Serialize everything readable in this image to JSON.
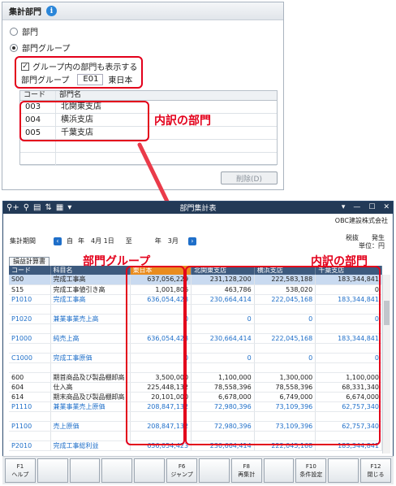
{
  "panel": {
    "title": "集計部門",
    "radio_dept": "部門",
    "radio_group": "部門グループ",
    "checkbox_label": "グループ内の部門も表示する",
    "group_label": "部門グループ",
    "group_code": "E01",
    "group_name": "東日本",
    "grid_headers": [
      "コード",
      "部門名"
    ],
    "grid_rows": [
      {
        "code": "003",
        "name": "北関東支店"
      },
      {
        "code": "004",
        "name": "横浜支店"
      },
      {
        "code": "005",
        "name": "千葉支店"
      }
    ],
    "delete_button": "削除(D)"
  },
  "callouts": {
    "detail_dept": "内訳の部門",
    "dept_group": "部門グループ"
  },
  "window": {
    "title": "部門集計表",
    "company": "OBC建設株式会社",
    "period_label": "集計期間",
    "period_from_prefix": "自",
    "period_from": "年　4月 1日",
    "period_to_prefix": "至",
    "period_to": "年　3月",
    "tax_label": "税抜　　発生",
    "unit_label": "単位：円",
    "tab_label": "損益計算書",
    "columns": [
      "コード",
      "科目名",
      "東日本",
      "北関東支店",
      "横浜支店",
      "千葉支店"
    ],
    "rows": [
      {
        "code": "S00",
        "name": "完成工事高",
        "v1": "637,056,229",
        "v2": "231,128,200",
        "v3": "222,583,188",
        "v4": "183,344,841",
        "style": "sel"
      },
      {
        "code": "S15",
        "name": "完成工事値引き高",
        "v1": "1,001,806",
        "v2": "463,786",
        "v3": "538,020",
        "v4": "0",
        "style": ""
      },
      {
        "code": "P1010",
        "name": "完成工事高",
        "v1": "636,054,423",
        "v2": "230,664,414",
        "v3": "222,045,168",
        "v4": "183,344,841",
        "style": "blue"
      },
      {
        "code": "",
        "name": "",
        "v1": "",
        "v2": "",
        "v3": "",
        "v4": "",
        "style": "gap"
      },
      {
        "code": "P1020",
        "name": "兼業事業売上高",
        "v1": "0",
        "v2": "0",
        "v3": "0",
        "v4": "0",
        "style": "blue"
      },
      {
        "code": "",
        "name": "",
        "v1": "",
        "v2": "",
        "v3": "",
        "v4": "",
        "style": "gap"
      },
      {
        "code": "P1000",
        "name": "純売上高",
        "v1": "636,054,423",
        "v2": "230,664,414",
        "v3": "222,045,168",
        "v4": "183,344,841",
        "style": "blue"
      },
      {
        "code": "",
        "name": "",
        "v1": "",
        "v2": "",
        "v3": "",
        "v4": "",
        "style": "gap"
      },
      {
        "code": "C1000",
        "name": "完成工事原価",
        "v1": "0",
        "v2": "0",
        "v3": "0",
        "v4": "0",
        "style": "blue"
      },
      {
        "code": "",
        "name": "",
        "v1": "",
        "v2": "",
        "v3": "",
        "v4": "",
        "style": "gap"
      },
      {
        "code": "600",
        "name": "期首商品及び製品棚卸高",
        "v1": "3,500,000",
        "v2": "1,100,000",
        "v3": "1,300,000",
        "v4": "1,100,000",
        "style": ""
      },
      {
        "code": "604",
        "name": "仕入高",
        "v1": "225,448,132",
        "v2": "78,558,396",
        "v3": "78,558,396",
        "v4": "68,331,340",
        "style": ""
      },
      {
        "code": "614",
        "name": "期末商品及び製品棚卸高",
        "v1": "20,101,000",
        "v2": "6,678,000",
        "v3": "6,749,000",
        "v4": "6,674,000",
        "style": ""
      },
      {
        "code": "P1110",
        "name": "兼業事業売上原価",
        "v1": "208,847,132",
        "v2": "72,980,396",
        "v3": "73,109,396",
        "v4": "62,757,340",
        "style": "blue"
      },
      {
        "code": "",
        "name": "",
        "v1": "",
        "v2": "",
        "v3": "",
        "v4": "",
        "style": "gap"
      },
      {
        "code": "P1100",
        "name": "売上原価",
        "v1": "208,847,132",
        "v2": "72,980,396",
        "v3": "73,109,396",
        "v4": "62,757,340",
        "style": "blue"
      },
      {
        "code": "",
        "name": "",
        "v1": "",
        "v2": "",
        "v3": "",
        "v4": "",
        "style": "gap"
      },
      {
        "code": "P2010",
        "name": "完成工事総利益",
        "v1": "636,054,423",
        "v2": "230,664,414",
        "v3": "222,045,168",
        "v4": "183,344,841",
        "style": "blue"
      }
    ]
  },
  "fkeys": [
    {
      "key": "F1",
      "label": "ヘルプ"
    },
    {
      "key": "",
      "label": ""
    },
    {
      "key": "",
      "label": ""
    },
    {
      "key": "",
      "label": ""
    },
    {
      "key": "",
      "label": ""
    },
    {
      "key": "F6",
      "label": "ジャンプ"
    },
    {
      "key": "",
      "label": ""
    },
    {
      "key": "F8",
      "label": "再集計"
    },
    {
      "key": "",
      "label": ""
    },
    {
      "key": "F10",
      "label": "条件設定"
    },
    {
      "key": "",
      "label": ""
    },
    {
      "key": "F12",
      "label": "閉じる"
    }
  ],
  "colors": {
    "accent_red": "#e3001b",
    "header_blue": "#3d5a7e",
    "highlight_orange": "#e98c1f",
    "link_blue": "#1f6fc9"
  }
}
